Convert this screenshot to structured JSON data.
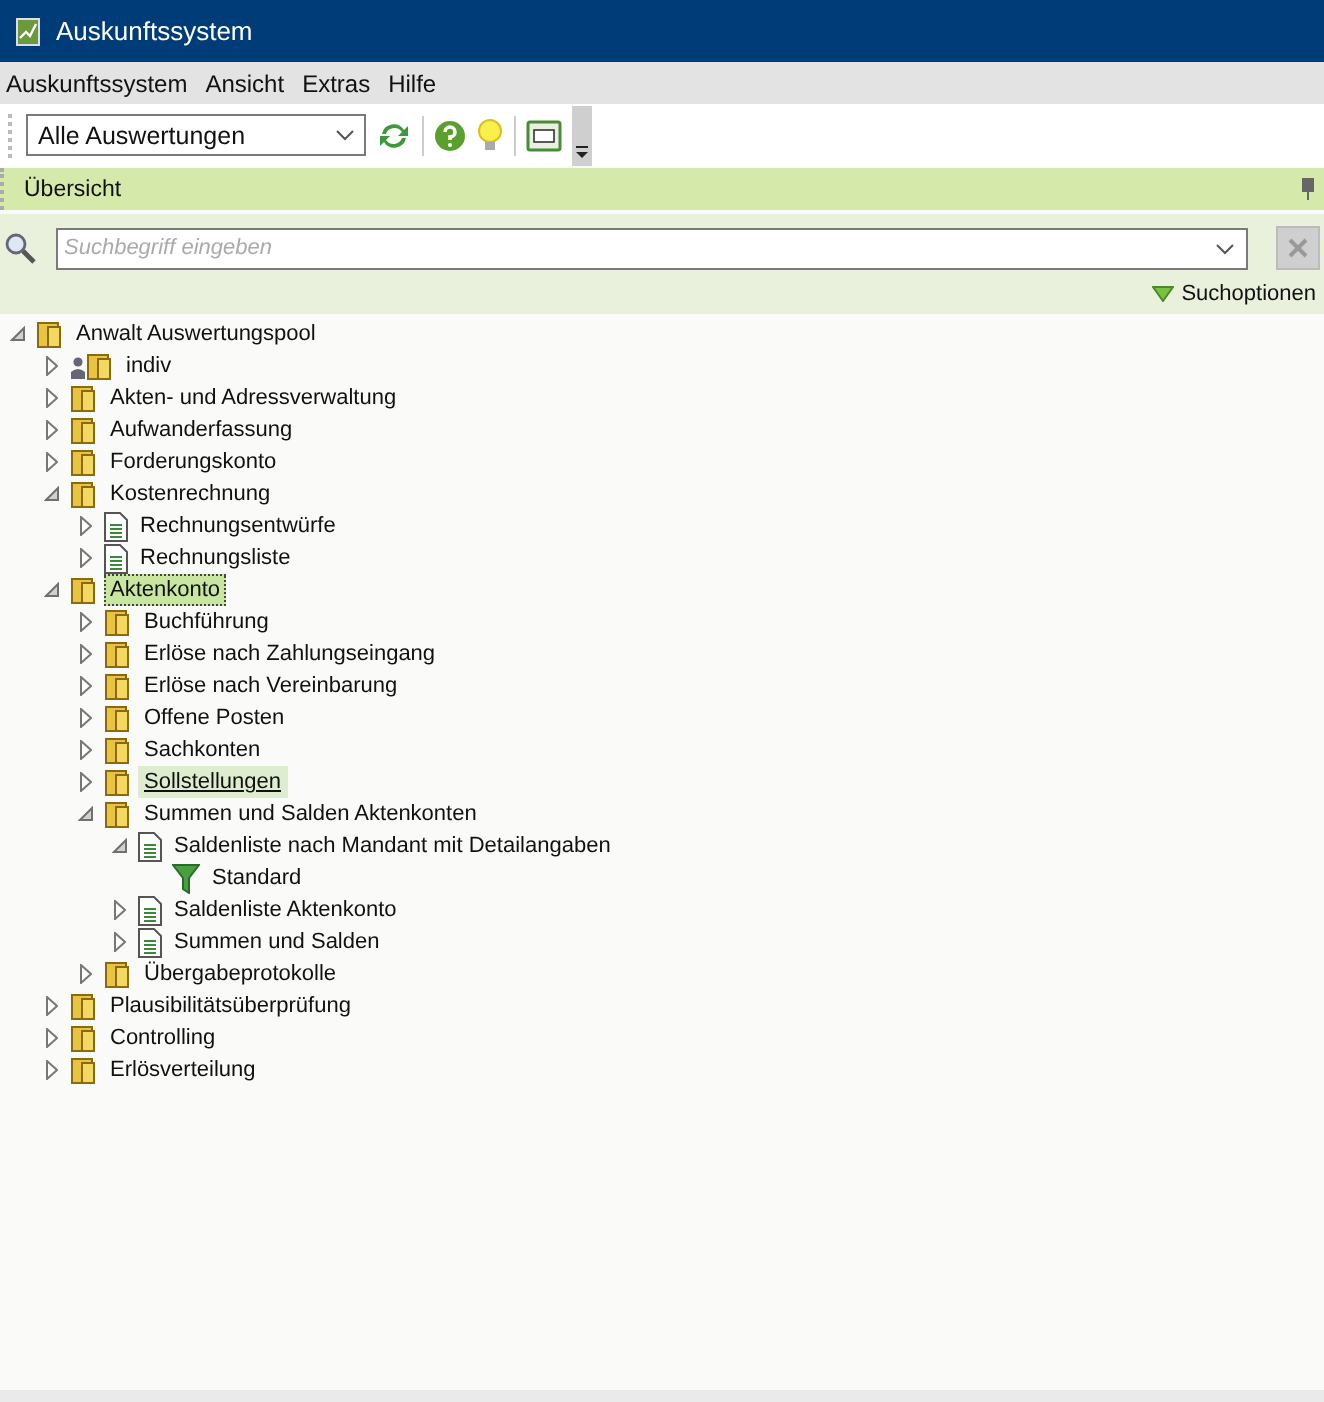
{
  "window": {
    "title": "Auskunftssystem"
  },
  "menu": [
    "Auskunftssystem",
    "Ansicht",
    "Extras",
    "Hilfe"
  ],
  "toolbar": {
    "view_select": {
      "value": "Alle Auswertungen"
    }
  },
  "panel": {
    "title": "Übersicht"
  },
  "search": {
    "placeholder": "Suchbegriff eingeben",
    "options_label": "Suchoptionen"
  },
  "tree": [
    {
      "label": "Anwalt Auswertungspool",
      "kind": "folder",
      "leaf": false,
      "expanded": true,
      "selected": false,
      "hovered": false,
      "children": [
        {
          "label": "indiv",
          "kind": "user-folder",
          "leaf": false,
          "expanded": false,
          "selected": false,
          "hovered": false
        },
        {
          "label": "Akten- und Adressverwaltung",
          "kind": "folder",
          "leaf": false,
          "expanded": false,
          "selected": false,
          "hovered": false
        },
        {
          "label": "Aufwanderfassung",
          "kind": "folder",
          "leaf": false,
          "expanded": false,
          "selected": false,
          "hovered": false
        },
        {
          "label": "Forderungskonto",
          "kind": "folder",
          "leaf": false,
          "expanded": false,
          "selected": false,
          "hovered": false
        },
        {
          "label": "Kostenrechnung",
          "kind": "folder",
          "leaf": false,
          "expanded": true,
          "selected": false,
          "hovered": false,
          "children": [
            {
              "label": "Rechnungsentwürfe",
              "kind": "document",
              "leaf": false,
              "expanded": false,
              "selected": false,
              "hovered": false
            },
            {
              "label": "Rechnungsliste",
              "kind": "document",
              "leaf": false,
              "expanded": false,
              "selected": false,
              "hovered": false
            }
          ]
        },
        {
          "label": "Aktenkonto",
          "kind": "folder",
          "leaf": false,
          "expanded": true,
          "selected": true,
          "hovered": false,
          "children": [
            {
              "label": "Buchführung",
              "kind": "folder",
              "leaf": false,
              "expanded": false,
              "selected": false,
              "hovered": false
            },
            {
              "label": "Erlöse nach Zahlungseingang",
              "kind": "folder",
              "leaf": false,
              "expanded": false,
              "selected": false,
              "hovered": false
            },
            {
              "label": "Erlöse nach Vereinbarung",
              "kind": "folder",
              "leaf": false,
              "expanded": false,
              "selected": false,
              "hovered": false
            },
            {
              "label": "Offene Posten",
              "kind": "folder",
              "leaf": false,
              "expanded": false,
              "selected": false,
              "hovered": false
            },
            {
              "label": "Sachkonten",
              "kind": "folder",
              "leaf": false,
              "expanded": false,
              "selected": false,
              "hovered": false
            },
            {
              "label": "Sollstellungen",
              "kind": "folder",
              "leaf": false,
              "expanded": false,
              "selected": false,
              "hovered": true
            },
            {
              "label": "Summen und Salden Aktenkonten",
              "kind": "folder",
              "leaf": false,
              "expanded": true,
              "selected": false,
              "hovered": false,
              "children": [
                {
                  "label": "Saldenliste nach Mandant mit Detailangaben",
                  "kind": "document",
                  "leaf": false,
                  "expanded": true,
                  "selected": false,
                  "hovered": false,
                  "children": [
                    {
                      "label": "Standard",
                      "kind": "filter",
                      "leaf": true,
                      "expanded": false,
                      "selected": false,
                      "hovered": false
                    }
                  ]
                },
                {
                  "label": "Saldenliste Aktenkonto",
                  "kind": "document",
                  "leaf": false,
                  "expanded": false,
                  "selected": false,
                  "hovered": false
                },
                {
                  "label": "Summen und Salden",
                  "kind": "document",
                  "leaf": false,
                  "expanded": false,
                  "selected": false,
                  "hovered": false
                }
              ]
            },
            {
              "label": "Übergabeprotokolle",
              "kind": "folder",
              "leaf": false,
              "expanded": false,
              "selected": false,
              "hovered": false
            }
          ]
        },
        {
          "label": "Plausibilitätsüberprüfung",
          "kind": "folder",
          "leaf": false,
          "expanded": false,
          "selected": false,
          "hovered": false
        },
        {
          "label": "Controlling",
          "kind": "folder",
          "leaf": false,
          "expanded": false,
          "selected": false,
          "hovered": false
        },
        {
          "label": "Erlösverteilung",
          "kind": "folder",
          "leaf": false,
          "expanded": false,
          "selected": false,
          "hovered": false
        }
      ]
    }
  ]
}
